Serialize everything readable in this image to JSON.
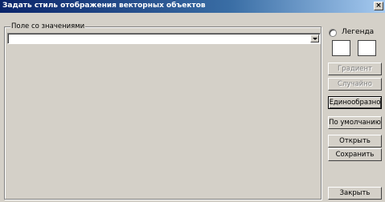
{
  "window": {
    "title": "Задать стиль отображения векторных объектов",
    "close_label": "×"
  },
  "group": {
    "label": "Поле со значениями"
  },
  "combo": {
    "value": ""
  },
  "legend": {
    "label": "Легенда"
  },
  "buttons": {
    "gradient": "Градиент",
    "random": "Случайно",
    "uniform": "Единообразно",
    "default": "По умолчанию",
    "open": "Открыть",
    "save": "Сохранить",
    "close": "Закрыть"
  }
}
